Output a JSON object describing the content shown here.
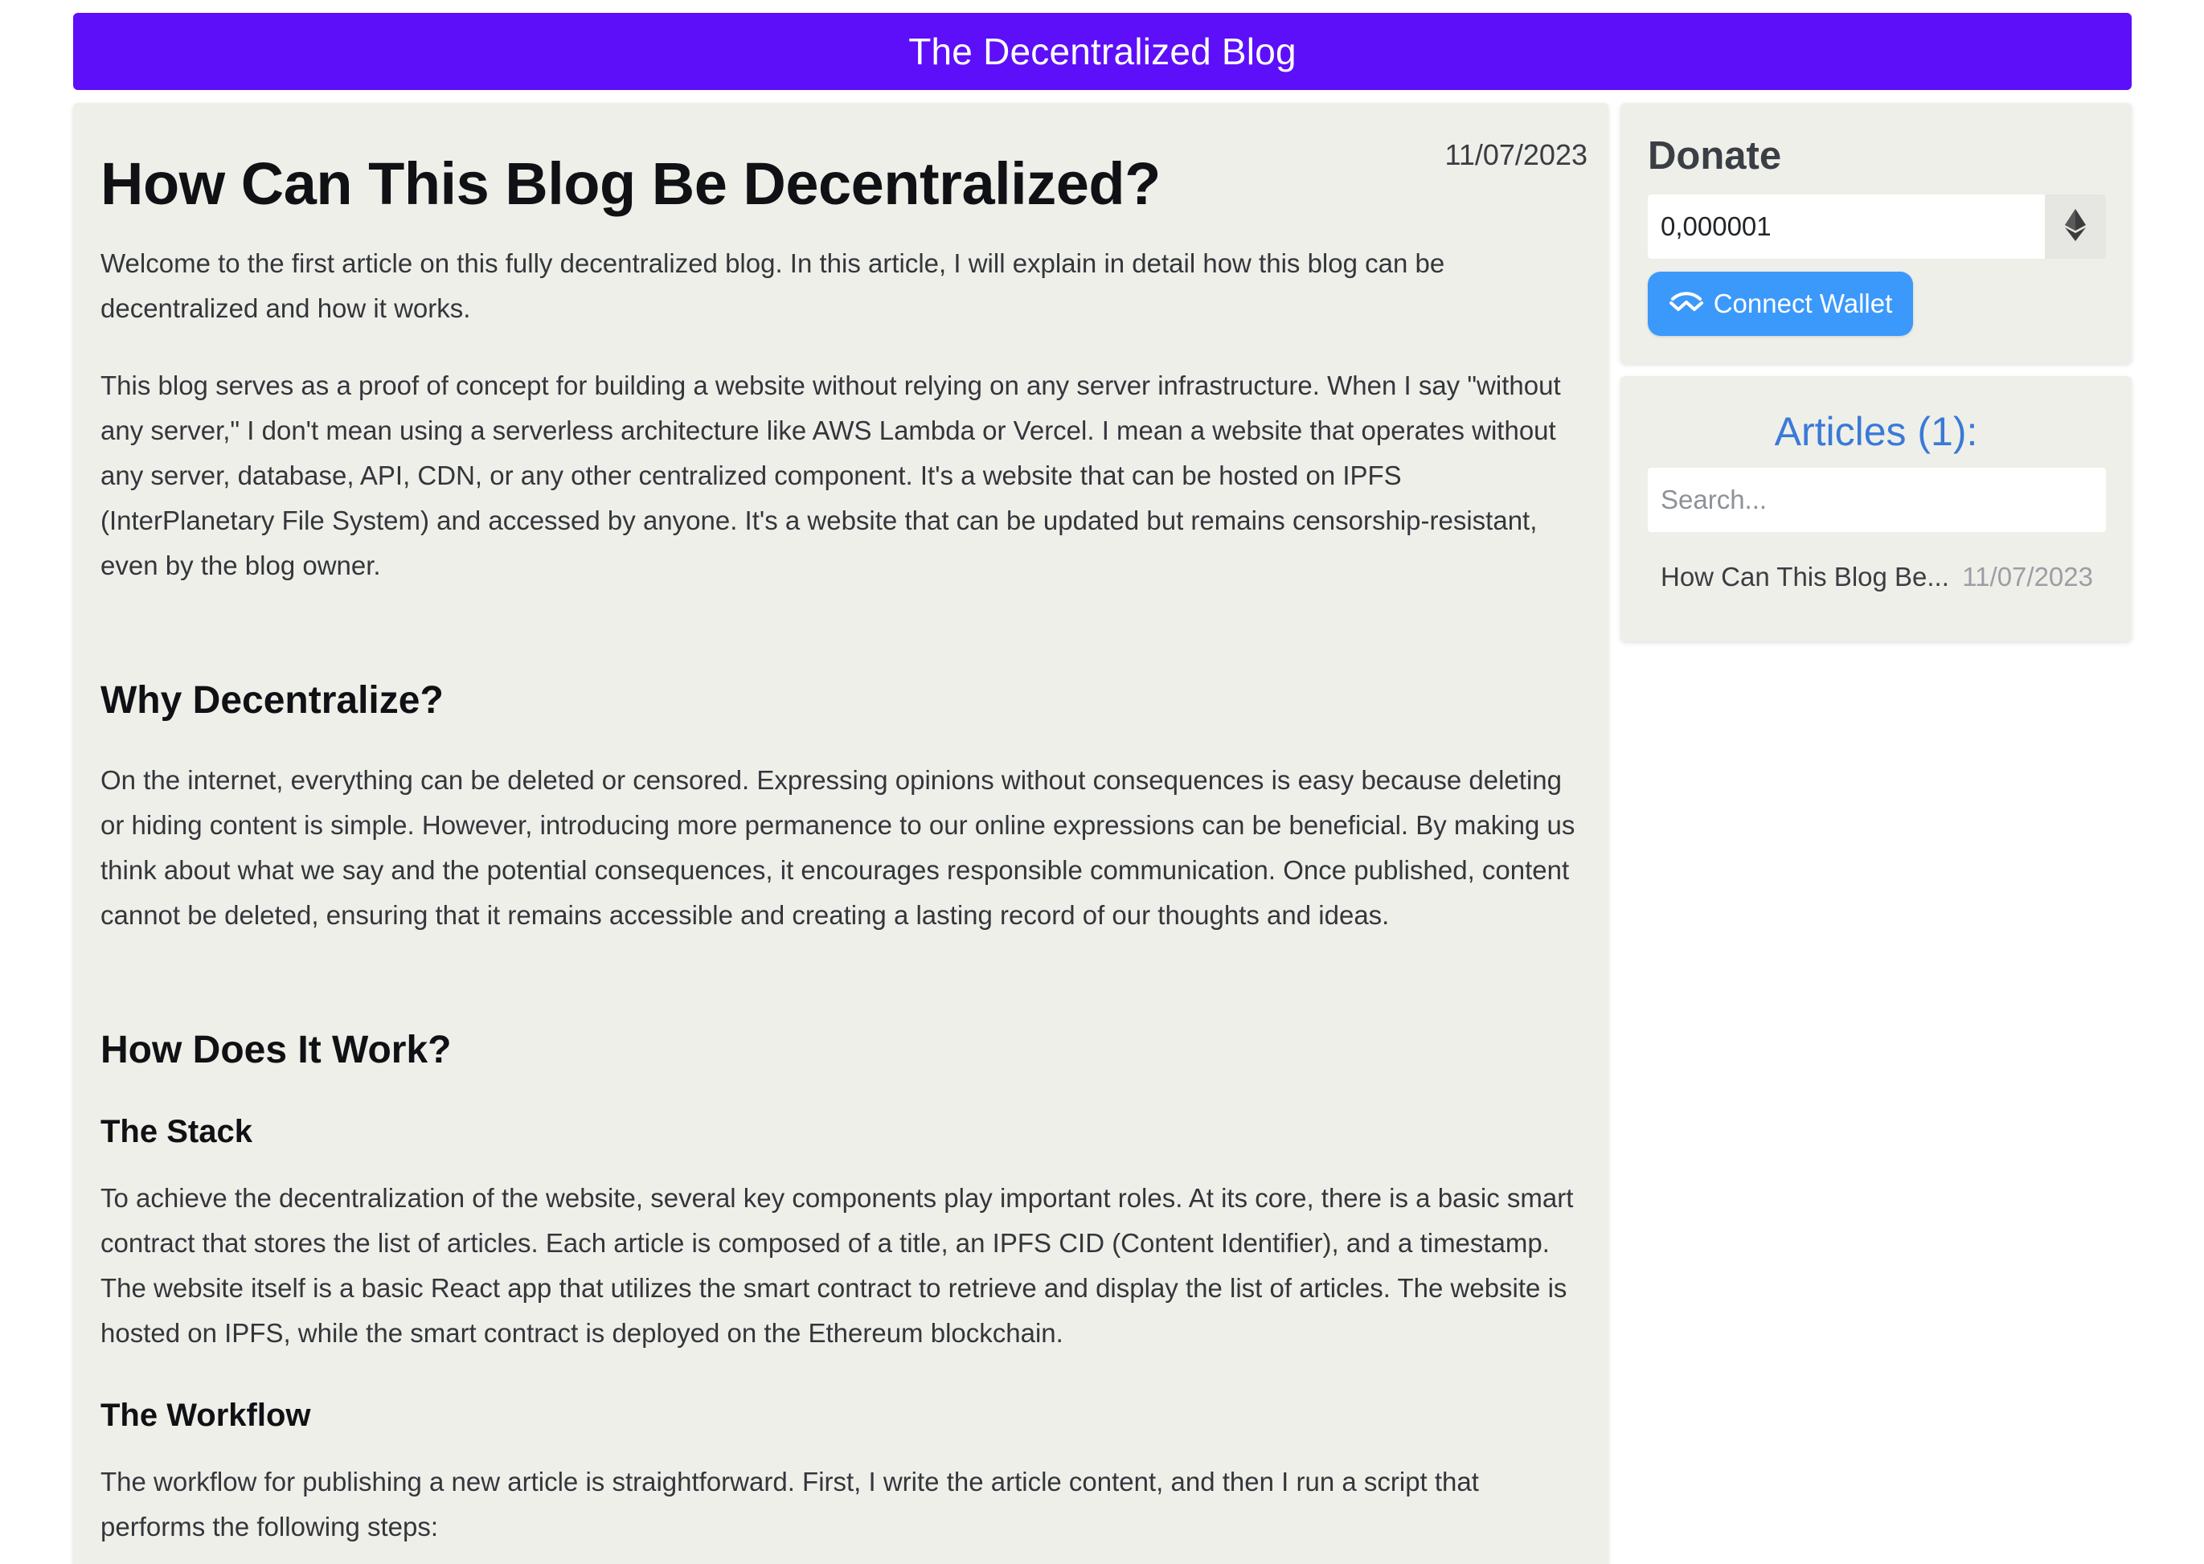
{
  "header": {
    "title": "The Decentralized Blog"
  },
  "article": {
    "title": "How Can This Blog Be Decentralized?",
    "date": "11/07/2023",
    "intro": "Welcome to the first article on this fully decentralized blog. In this article, I will explain in detail how this blog can be decentralized and how it works.",
    "para2": "This blog serves as a proof of concept for building a website without relying on any server infrastructure. When I say \"without any server,\" I don't mean using a serverless architecture like AWS Lambda or Vercel. I mean a website that operates without any server, database, API, CDN, or any other centralized component. It's a website that can be hosted on IPFS (InterPlanetary File System) and accessed by anyone. It's a website that can be updated but remains censorship-resistant, even by the blog owner.",
    "section1": {
      "heading": "Why Decentralize?",
      "text": "On the internet, everything can be deleted or censored. Expressing opinions without consequences is easy because deleting or hiding content is simple. However, introducing more permanence to our online expressions can be beneficial. By making us think about what we say and the potential consequences, it encourages responsible communication. Once published, content cannot be deleted, ensuring that it remains accessible and creating a lasting record of our thoughts and ideas."
    },
    "section2": {
      "heading": "How Does It Work?",
      "sub1": {
        "heading": "The Stack",
        "text": "To achieve the decentralization of the website, several key components play important roles. At its core, there is a basic smart contract that stores the list of articles. Each article is composed of a title, an IPFS CID (Content Identifier), and a timestamp. The website itself is a basic React app that utilizes the smart contract to retrieve and display the list of articles. The website is hosted on IPFS, while the smart contract is deployed on the Ethereum blockchain."
      },
      "sub2": {
        "heading": "The Workflow",
        "text": "The workflow for publishing a new article is straightforward. First, I write the article content, and then I run a script that performs the following steps:"
      }
    }
  },
  "donate": {
    "title": "Donate",
    "amount": "0,000001",
    "currency_icon": "ethereum-icon",
    "connect_label": "Connect Wallet",
    "connect_icon": "walletconnect-icon",
    "accent_color": "#3b99fc"
  },
  "articles_panel": {
    "title": "Articles (1):",
    "search_placeholder": "Search...",
    "items": [
      {
        "title": "How Can This Blog Be...",
        "date": "11/07/2023"
      }
    ]
  },
  "colors": {
    "header_bg": "#5c0ff8",
    "card_bg": "#efefe9",
    "articles_title": "#3a7ad8"
  }
}
